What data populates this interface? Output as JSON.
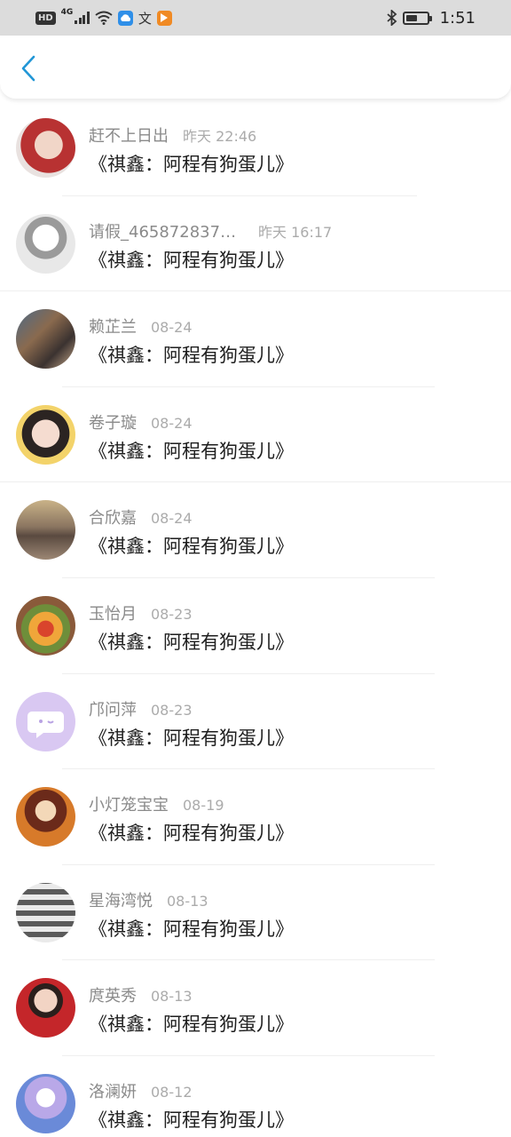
{
  "status_bar": {
    "hd": "HD",
    "network": "4G",
    "time": "1:51",
    "battery_level": 0.55,
    "icons": [
      "signal-icon",
      "wifi-icon",
      "cloud-app-icon",
      "translate-app-icon",
      "video-app-icon",
      "bluetooth-icon",
      "battery-icon"
    ]
  },
  "header": {
    "back_icon": "chevron-left-icon",
    "accent": "#2196d6"
  },
  "message_preview": "《祺鑫：阿程有狗蛋儿》",
  "items": [
    {
      "name": "赶不上日出",
      "time": "昨天 22:46",
      "message": "《祺鑫：阿程有狗蛋儿》",
      "avatar": "user-photo-red-hood"
    },
    {
      "name": "请假_4658728378...",
      "time": "昨天 16:17",
      "message": "《祺鑫：阿程有狗蛋儿》",
      "avatar": "anime-girl-sketch"
    },
    {
      "name": "赖芷兰",
      "time": "08-24",
      "message": "《祺鑫：阿程有狗蛋儿》",
      "avatar": "user-photo-group"
    },
    {
      "name": "卷子璇",
      "time": "08-24",
      "message": "《祺鑫：阿程有狗蛋儿》",
      "avatar": "user-photo-glasses"
    },
    {
      "name": "合欣嘉",
      "time": "08-24",
      "message": "《祺鑫：阿程有狗蛋儿》",
      "avatar": "user-photo-sea"
    },
    {
      "name": "玉怡月",
      "time": "08-23",
      "message": "《祺鑫：阿程有狗蛋儿》",
      "avatar": "food-photo"
    },
    {
      "name": "邝问萍",
      "time": "08-23",
      "message": "《祺鑫：阿程有狗蛋儿》",
      "avatar": "default-chat-bubble-avatar"
    },
    {
      "name": "小灯笼宝宝",
      "time": "08-19",
      "message": "《祺鑫：阿程有狗蛋儿》",
      "avatar": "anime-warrior-art"
    },
    {
      "name": "星海湾悦",
      "time": "08-13",
      "message": "《祺鑫：阿程有狗蛋儿》",
      "avatar": "user-photo-striped"
    },
    {
      "name": "庹英秀",
      "time": "08-13",
      "message": "《祺鑫：阿程有狗蛋儿》",
      "avatar": "user-photo-red-dress"
    },
    {
      "name": "洛澜妍",
      "time": "08-12",
      "message": "《祺鑫：阿程有狗蛋儿》",
      "avatar": "anime-fantasy-art"
    }
  ]
}
